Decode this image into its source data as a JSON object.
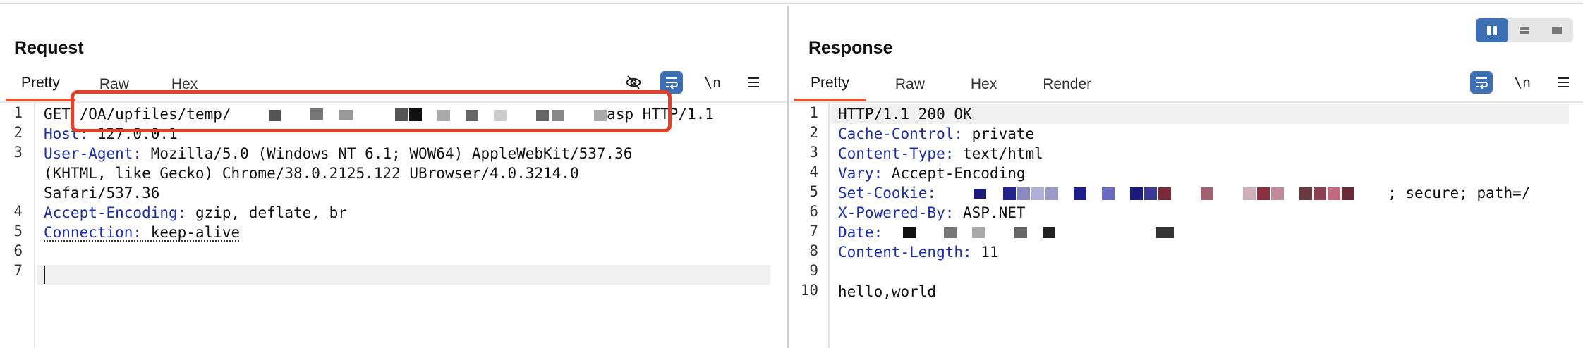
{
  "request": {
    "title": "Request",
    "tabs": [
      "Pretty",
      "Raw",
      "Hex"
    ],
    "active_tab": "Pretty",
    "tools": {
      "eye_icon": "eye-slash-icon",
      "wrap_icon": "wrap-lines-icon",
      "newline_label": "\\n",
      "menu_icon": "hamburger-menu-icon"
    },
    "line_numbers": [
      "1",
      "2",
      "3",
      "4",
      "5",
      "6",
      "7"
    ],
    "lines": {
      "l1_method": "GET",
      "l1_path": "/OA/upfiles/temp/",
      "l1_ext": ".asp HTTP/1.1",
      "l2_key": "Host:",
      "l2_val": " 127.0.0.1",
      "l3_key": "User-Agent:",
      "l3_val": " Mozilla/5.0 (Windows NT 6.1; WOW64) AppleWebKit/537.36",
      "l3_wrap1": "(KHTML, like Gecko) Chrome/38.0.2125.122 UBrowser/4.0.3214.0",
      "l3_wrap2": "Safari/537.36",
      "l4_key": "Accept-Encoding:",
      "l4_val": " gzip, deflate, br",
      "l5_key": "Connection:",
      "l5_val": " keep-alive"
    }
  },
  "response": {
    "title": "Response",
    "tabs": [
      "Pretty",
      "Raw",
      "Hex",
      "Render"
    ],
    "active_tab": "Pretty",
    "tools": {
      "wrap_icon": "wrap-lines-icon",
      "newline_label": "\\n",
      "menu_icon": "hamburger-menu-icon"
    },
    "line_numbers": [
      "1",
      "2",
      "3",
      "4",
      "5",
      "6",
      "7",
      "8",
      "9",
      "10"
    ],
    "lines": {
      "l1": "HTTP/1.1 200 OK",
      "l2_key": "Cache-Control:",
      "l2_val": " private",
      "l3_key": "Content-Type:",
      "l3_val": " text/html",
      "l4_key": "Vary:",
      "l4_val": " Accept-Encoding",
      "l5_key": "Set-Cookie:",
      "l5_tail": "; secure; path=/",
      "l6_key": "X-Powered-By:",
      "l6_val": " ASP.NET",
      "l7_key": "Date:",
      "l8_key": "Content-Length:",
      "l8_val": " 11",
      "l10": "hello,world"
    }
  },
  "view_toggle": {
    "options": [
      "side-by-side-icon",
      "stacked-icon",
      "single-icon"
    ],
    "active": "side-by-side-icon"
  },
  "colors": {
    "accent": "#e4572e",
    "highlight_box": "#e2402a",
    "primary_button": "#3d6fb4",
    "header_key": "#1c2eb0"
  }
}
